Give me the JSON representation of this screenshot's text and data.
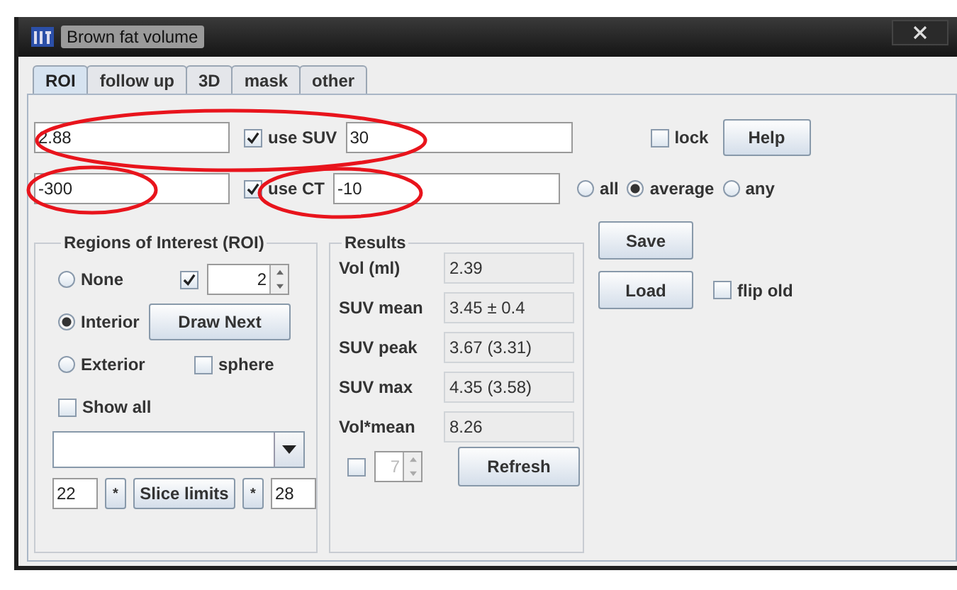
{
  "window": {
    "title": "Brown fat volume"
  },
  "tabs": [
    {
      "label": "ROI",
      "selected": true
    },
    {
      "label": "follow up",
      "selected": false
    },
    {
      "label": "3D",
      "selected": false
    },
    {
      "label": "mask",
      "selected": false
    },
    {
      "label": "other",
      "selected": false
    }
  ],
  "thresholds": [
    {
      "value": "2.88",
      "checked": true,
      "label": "use SUV",
      "limit": "30"
    },
    {
      "value": "-300",
      "checked": true,
      "label": "use CT",
      "limit": "-10"
    }
  ],
  "lock": {
    "label": "lock",
    "checked": false
  },
  "help_button": "Help",
  "match_modes": [
    {
      "label": "all",
      "selected": false
    },
    {
      "label": "average",
      "selected": true
    },
    {
      "label": "any",
      "selected": false
    }
  ],
  "save_button": "Save",
  "load_button": "Load",
  "flip_old": {
    "label": "flip old",
    "checked": false
  },
  "roi": {
    "title": "Regions of Interest (ROI)",
    "modes": [
      {
        "label": "None",
        "selected": false
      },
      {
        "label": "Interior",
        "selected": true
      },
      {
        "label": "Exterior",
        "selected": false
      }
    ],
    "count_enabled": {
      "checked": true
    },
    "count": "2",
    "draw_next": "Draw Next",
    "sphere": {
      "label": "sphere",
      "checked": false
    },
    "show_all": {
      "label": "Show all",
      "checked": false
    },
    "slice_start": "22",
    "star_left": "*",
    "slice_limits": "Slice limits",
    "star_right": "*",
    "slice_end": "28"
  },
  "results": {
    "title": "Results",
    "rows": [
      {
        "label": "Vol (ml)",
        "value": "2.39"
      },
      {
        "label": "SUV mean",
        "value": "3.45 ± 0.4"
      },
      {
        "label": "SUV peak",
        "value": "3.67  (3.31)"
      },
      {
        "label": "SUV max",
        "value": "4.35  (3.58)"
      },
      {
        "label": "Vol*mean",
        "value": "8.26"
      }
    ],
    "smooth": {
      "checked": false
    },
    "smooth_value": "7",
    "smooth_disabled": true,
    "refresh": "Refresh"
  }
}
